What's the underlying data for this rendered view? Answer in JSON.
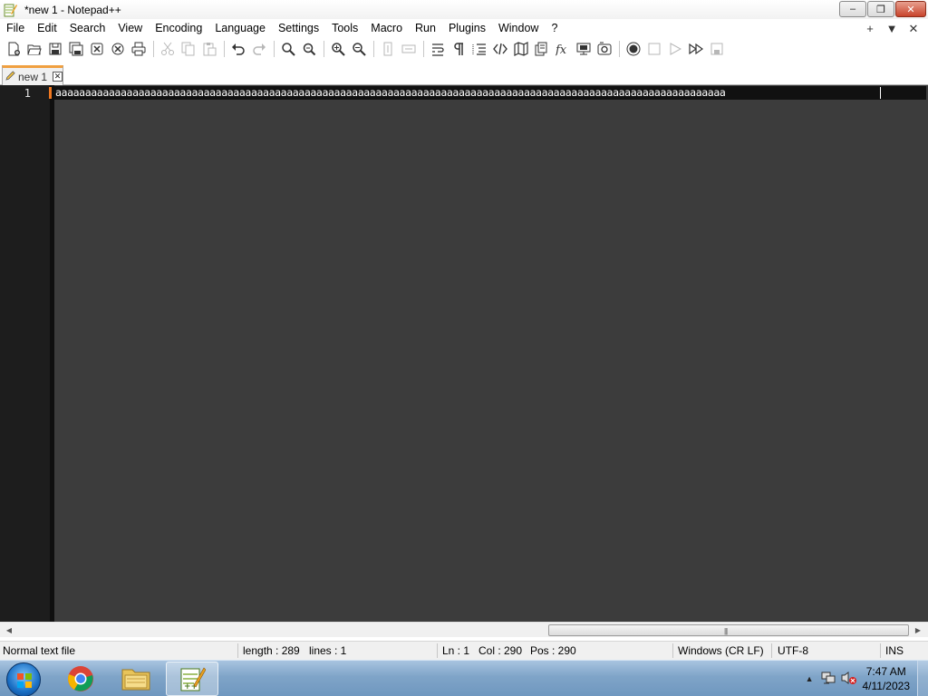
{
  "window": {
    "title": "*new 1 - Notepad++",
    "controls": {
      "minimize": "–",
      "maximize": "❐",
      "close": "✕"
    }
  },
  "menu": {
    "items": [
      "File",
      "Edit",
      "Search",
      "View",
      "Encoding",
      "Language",
      "Settings",
      "Tools",
      "Macro",
      "Run",
      "Plugins",
      "Window",
      "?"
    ],
    "right_icons": [
      "+",
      "▼",
      "✕"
    ]
  },
  "toolbar": {
    "buttons": [
      {
        "icon": "new-file-icon",
        "enabled": true
      },
      {
        "icon": "open-file-icon",
        "enabled": true
      },
      {
        "icon": "save-icon",
        "enabled": true
      },
      {
        "icon": "save-all-icon",
        "enabled": true
      },
      {
        "icon": "close-icon",
        "enabled": true
      },
      {
        "icon": "close-all-icon",
        "enabled": true
      },
      {
        "icon": "print-icon",
        "enabled": true
      },
      {
        "icon": "cut-icon",
        "enabled": false
      },
      {
        "icon": "copy-icon",
        "enabled": false
      },
      {
        "icon": "paste-icon",
        "enabled": false
      },
      {
        "icon": "undo-icon",
        "enabled": true
      },
      {
        "icon": "redo-icon",
        "enabled": false
      },
      {
        "icon": "find-icon",
        "enabled": true
      },
      {
        "icon": "replace-icon",
        "enabled": true
      },
      {
        "icon": "zoom-in-icon",
        "enabled": true
      },
      {
        "icon": "zoom-out-icon",
        "enabled": true
      },
      {
        "icon": "sync-vertical-icon",
        "enabled": false
      },
      {
        "icon": "sync-horizontal-icon",
        "enabled": false
      },
      {
        "icon": "word-wrap-icon",
        "enabled": true
      },
      {
        "icon": "show-all-chars-icon",
        "enabled": true
      },
      {
        "icon": "indent-guide-icon",
        "enabled": true
      },
      {
        "icon": "udl-icon",
        "enabled": true
      },
      {
        "icon": "doc-map-icon",
        "enabled": true
      },
      {
        "icon": "doc-list-icon",
        "enabled": true
      },
      {
        "icon": "function-list-icon",
        "enabled": true
      },
      {
        "icon": "folder-workspace-icon",
        "enabled": true
      },
      {
        "icon": "monitoring-icon",
        "enabled": true
      },
      {
        "icon": "record-macro-icon",
        "enabled": true
      },
      {
        "icon": "stop-macro-icon",
        "enabled": false
      },
      {
        "icon": "play-macro-icon",
        "enabled": false
      },
      {
        "icon": "run-macro-multiple-icon",
        "enabled": true
      },
      {
        "icon": "save-macro-icon",
        "enabled": false
      }
    ]
  },
  "tabs": [
    {
      "label": "new 1",
      "icon": "pencil-icon",
      "active": true
    }
  ],
  "editor": {
    "line_number": "1",
    "line_text": "aaaaaaaaaaaaaaaaaaaaaaaaaaaaaaaaaaaaaaaaaaaaaaaaaaaaaaaaaaaaaaaaaaaaaaaaaaaaaaaaaaaaaaaaaaaaaaaaaaaaaaaaaaaaaaaaa"
  },
  "status": {
    "file_type": "Normal text file",
    "length": "length : 289",
    "lines": "lines : 1",
    "ln": "Ln : 1",
    "col": "Col : 290",
    "pos": "Pos : 290",
    "eol": "Windows (CR LF)",
    "encoding": "UTF-8",
    "mode": "INS"
  },
  "taskbar": {
    "apps": [
      "chrome-icon",
      "file-explorer-icon",
      "notepad-plus-plus-icon"
    ],
    "clock_time": "7:47 AM",
    "clock_date": "4/11/2023"
  },
  "colors": {
    "editor_bg": "#3c3c3c",
    "gutter_bg": "#1d1d1d",
    "current_line_bg": "#111111",
    "tab_accent": "#f0a040"
  }
}
